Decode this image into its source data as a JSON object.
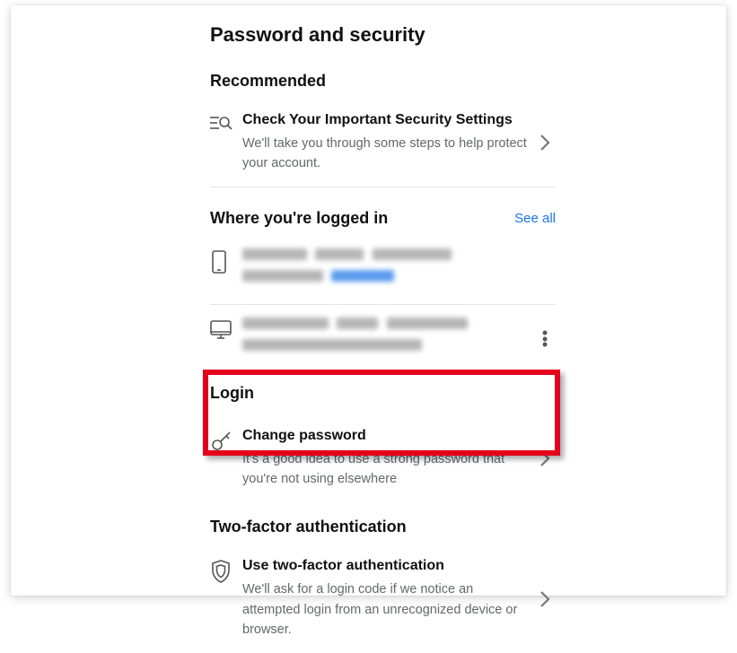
{
  "page_title": "Password and security",
  "sections": {
    "recommended": {
      "header": "Recommended",
      "item": {
        "title": "Check Your Important Security Settings",
        "sub": "We'll take you through some steps to help protect your account."
      }
    },
    "logged_in": {
      "header": "Where you're logged in",
      "see_all": "See all"
    },
    "login": {
      "header": "Login",
      "item": {
        "title": "Change password",
        "sub": "It's a good idea to use a strong password that you're not using elsewhere"
      }
    },
    "tfa": {
      "header": "Two-factor authentication",
      "item": {
        "title": "Use two-factor authentication",
        "sub": "We'll ask for a login code if we notice an attempted login from an unrecognized device or browser."
      }
    }
  }
}
